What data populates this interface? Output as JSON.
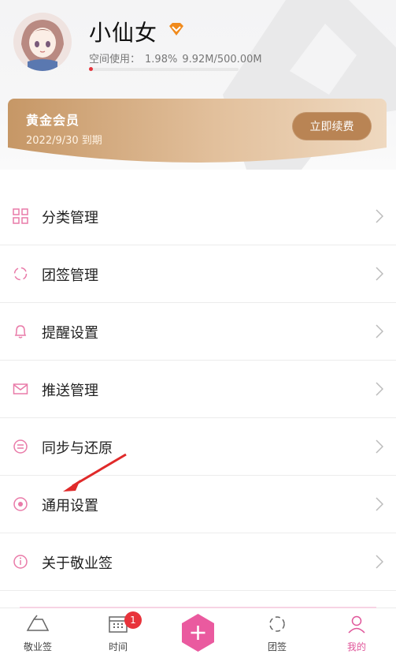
{
  "profile": {
    "username": "小仙女",
    "space_label": "空间使用：",
    "space_percent": "1.98%",
    "space_amount": "9.92M/500.00M",
    "space_usage_fraction": 0.0198
  },
  "membership": {
    "title": "黄金会员",
    "expiry": "2022/9/30 到期",
    "renew_label": "立即续费"
  },
  "menu": {
    "items": [
      {
        "label": "分类管理",
        "icon": "category-grid-icon"
      },
      {
        "label": "团签管理",
        "icon": "team-icon"
      },
      {
        "label": "提醒设置",
        "icon": "bell-icon"
      },
      {
        "label": "推送管理",
        "icon": "mail-icon"
      },
      {
        "label": "同步与还原",
        "icon": "sync-icon"
      },
      {
        "label": "通用设置",
        "icon": "settings-dot-icon"
      },
      {
        "label": "关于敬业签",
        "icon": "info-icon"
      }
    ]
  },
  "tabbar": {
    "items": [
      {
        "label": "敬业签",
        "icon": "note-icon"
      },
      {
        "label": "时间",
        "icon": "calendar-icon",
        "badge": "1"
      },
      {
        "label": "",
        "icon": "add-icon"
      },
      {
        "label": "团签",
        "icon": "team-icon"
      },
      {
        "label": "我的",
        "icon": "person-icon",
        "active": true
      }
    ]
  },
  "colors": {
    "accent_pink": "#e0569a",
    "gold_card": "#c9996a",
    "badge_red": "#e8333b",
    "vip_orange": "#f08a1c"
  }
}
